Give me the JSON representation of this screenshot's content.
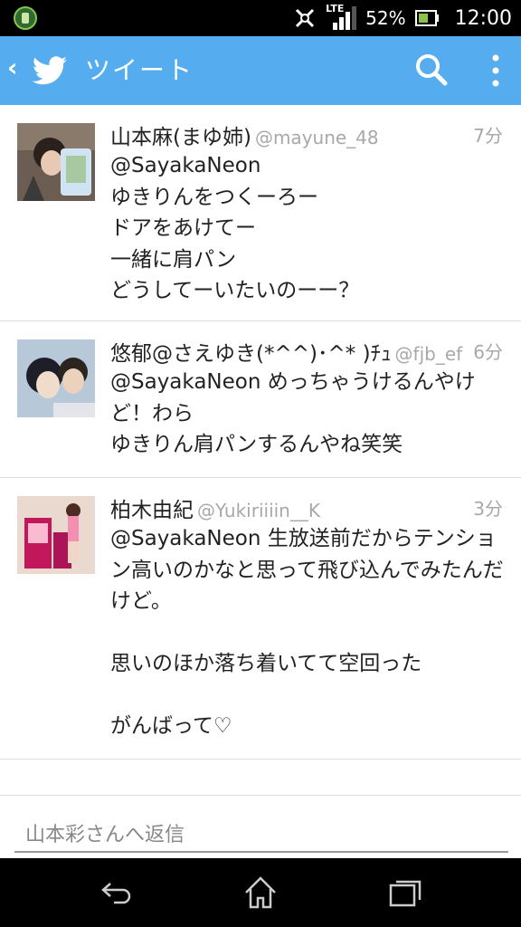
{
  "status_bar": {
    "network": "LTE",
    "battery": "52%",
    "time": "12:00",
    "icons": [
      "app-notification-icon",
      "vibrate-icon",
      "signal-icon",
      "battery-icon"
    ]
  },
  "app_bar": {
    "title": "ツイート",
    "icons": [
      "back-icon",
      "twitter-bird-icon",
      "search-icon",
      "overflow-menu-icon"
    ],
    "accent_color": "#55acee"
  },
  "tweets": [
    {
      "name": "山本麻(まゆ姉)",
      "handle": "@mayune_48",
      "time": "7分",
      "text": "@SayakaNeon\nゆきりんをつくーろー\nドアをあけてー\n一緒に肩パン\nどうしてーいたいのーー？"
    },
    {
      "name": "悠郁@さえゆき(*^^)･^* )ﾁｭ",
      "handle": "@fjb_ef",
      "time": "6分",
      "text": "@SayakaNeon めっちゃうけるんやけど！わら\nゆきりん肩パンするんやね笑笑"
    },
    {
      "name": "柏木由紀",
      "handle": "@Yukiriiiin__K",
      "time": "3分",
      "text": "@SayakaNeon 生放送前だからテンション高いのかなと思って飛び込んでみたんだけど。\n\n思いのほか落ち着いてて空回った\n\nがんばって♡"
    }
  ],
  "reply": {
    "placeholder": "山本彩さんへ返信"
  },
  "nav_bar": {
    "icons": [
      "back-nav-icon",
      "home-nav-icon",
      "recent-apps-icon"
    ]
  }
}
